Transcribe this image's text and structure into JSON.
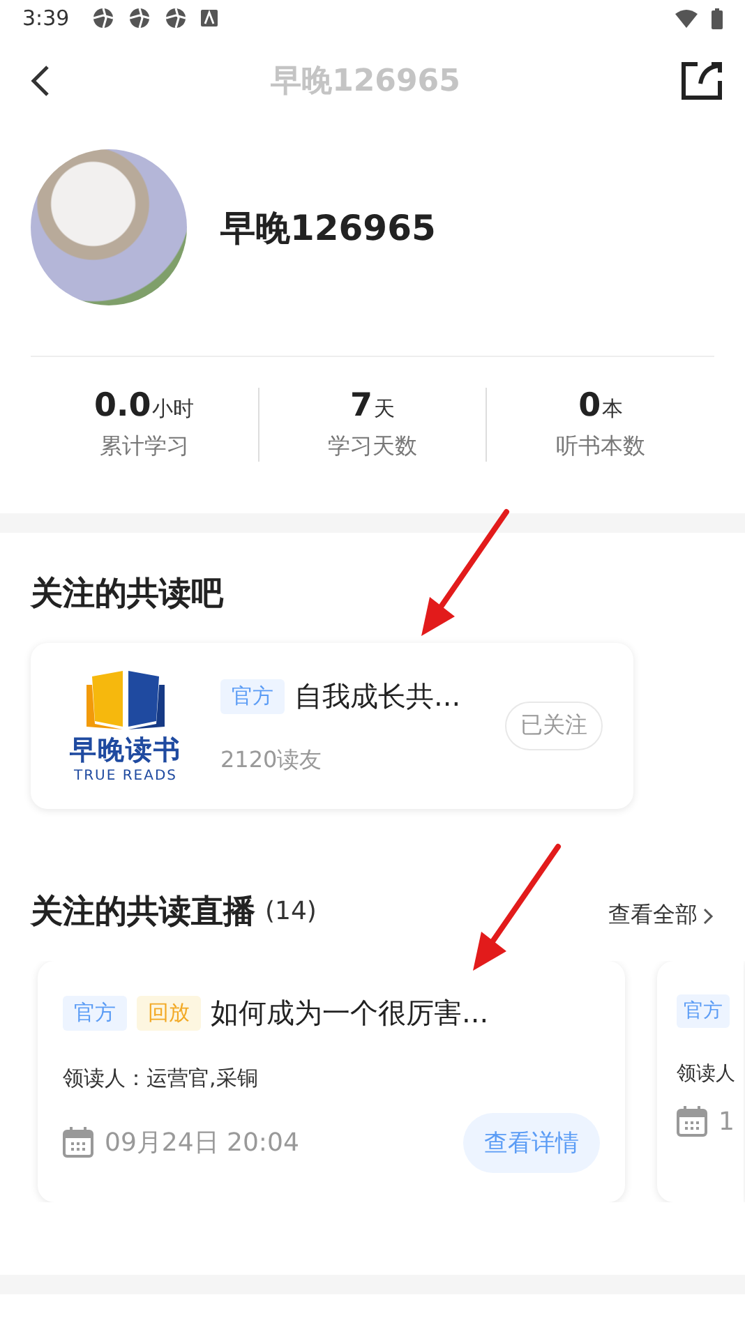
{
  "status_bar": {
    "time": "3:39"
  },
  "header": {
    "title": "早晚126965"
  },
  "profile": {
    "name": "早晚126965"
  },
  "stats": [
    {
      "value": "0.0",
      "unit": "小时",
      "label": "累计学习"
    },
    {
      "value": "7",
      "unit": "天",
      "label": "学习天数"
    },
    {
      "value": "0",
      "unit": "本",
      "label": "听书本数"
    }
  ],
  "followed_groups": {
    "title": "关注的共读吧",
    "items": [
      {
        "logo_name": "早晚读书",
        "logo_tagline": "TRUE READS",
        "tag": "官方",
        "name": "自我成长共...",
        "members": "2120读友",
        "follow_button": "已关注"
      }
    ]
  },
  "live_section": {
    "title": "关注的共读直播",
    "count": "(14)",
    "see_all": "查看全部",
    "cards": [
      {
        "kind": "full",
        "tags": [
          {
            "label": "官方",
            "kind": "official"
          },
          {
            "label": "回放",
            "kind": "replay"
          }
        ],
        "title": "如何成为一个很厉害...",
        "leader": "领读人：运营官,采铜",
        "date": "09月24日 20:04",
        "button": "查看详情"
      },
      {
        "kind": "peek",
        "tags": [
          {
            "label": "官方",
            "kind": "official"
          }
        ],
        "leader": "领读人",
        "date": "1"
      }
    ]
  }
}
